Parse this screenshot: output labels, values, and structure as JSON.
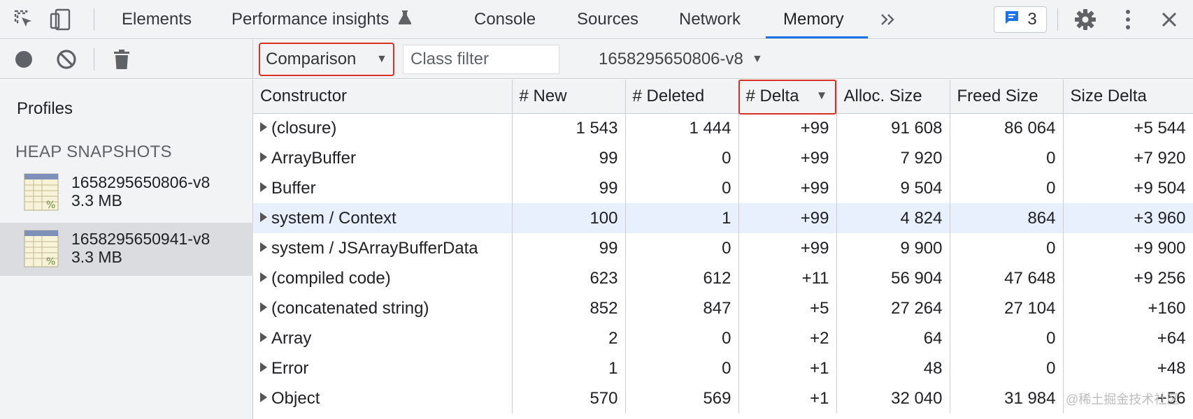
{
  "tabs": [
    {
      "label": "Elements"
    },
    {
      "label": "Performance insights"
    },
    {
      "label": "Console"
    },
    {
      "label": "Sources"
    },
    {
      "label": "Network"
    },
    {
      "label": "Memory",
      "active": true
    }
  ],
  "issues": {
    "count": "3"
  },
  "toolbar": {
    "view_mode": "Comparison",
    "class_filter_placeholder": "Class filter",
    "base_snapshot": "1658295650806-v8"
  },
  "sidebar": {
    "title": "Profiles",
    "section": "HEAP SNAPSHOTS",
    "snapshots": [
      {
        "name": "1658295650806-v8",
        "size": "3.3 MB",
        "selected": false
      },
      {
        "name": "1658295650941-v8",
        "size": "3.3 MB",
        "selected": true
      }
    ]
  },
  "table": {
    "columns": [
      "Constructor",
      "# New",
      "# Deleted",
      "# Delta",
      "Alloc. Size",
      "Freed Size",
      "Size Delta"
    ],
    "sorted_column": "# Delta",
    "rows": [
      {
        "constructor": "(closure)",
        "new": "1 543",
        "deleted": "1 444",
        "delta": "+99",
        "alloc": "91 608",
        "freed": "86 064",
        "size_delta": "+5 544"
      },
      {
        "constructor": "ArrayBuffer",
        "new": "99",
        "deleted": "0",
        "delta": "+99",
        "alloc": "7 920",
        "freed": "0",
        "size_delta": "+7 920"
      },
      {
        "constructor": "Buffer",
        "new": "99",
        "deleted": "0",
        "delta": "+99",
        "alloc": "9 504",
        "freed": "0",
        "size_delta": "+9 504"
      },
      {
        "constructor": "system / Context",
        "new": "100",
        "deleted": "1",
        "delta": "+99",
        "alloc": "4 824",
        "freed": "864",
        "size_delta": "+3 960",
        "highlighted": true
      },
      {
        "constructor": "system / JSArrayBufferData",
        "new": "99",
        "deleted": "0",
        "delta": "+99",
        "alloc": "9 900",
        "freed": "0",
        "size_delta": "+9 900"
      },
      {
        "constructor": "(compiled code)",
        "new": "623",
        "deleted": "612",
        "delta": "+11",
        "alloc": "56 904",
        "freed": "47 648",
        "size_delta": "+9 256"
      },
      {
        "constructor": "(concatenated string)",
        "new": "852",
        "deleted": "847",
        "delta": "+5",
        "alloc": "27 264",
        "freed": "27 104",
        "size_delta": "+160"
      },
      {
        "constructor": "Array",
        "new": "2",
        "deleted": "0",
        "delta": "+2",
        "alloc": "64",
        "freed": "0",
        "size_delta": "+64"
      },
      {
        "constructor": "Error",
        "new": "1",
        "deleted": "0",
        "delta": "+1",
        "alloc": "48",
        "freed": "0",
        "size_delta": "+48"
      },
      {
        "constructor": "Object",
        "new": "570",
        "deleted": "569",
        "delta": "+1",
        "alloc": "32 040",
        "freed": "31 984",
        "size_delta": "+56"
      }
    ]
  },
  "watermark": "@稀土掘金技术社区",
  "colors": {
    "accent": "#1a73e8",
    "highlight_border": "#d93025",
    "selected_row": "#e8f0fe"
  },
  "icons": [
    "inspect-element-icon",
    "device-toolbar-icon",
    "flask-icon",
    "more-tabs-icon",
    "issues-icon",
    "gear-icon",
    "kebab-menu-icon",
    "close-icon",
    "record-icon",
    "clear-icon",
    "trash-icon",
    "heap-snapshot-icon"
  ]
}
